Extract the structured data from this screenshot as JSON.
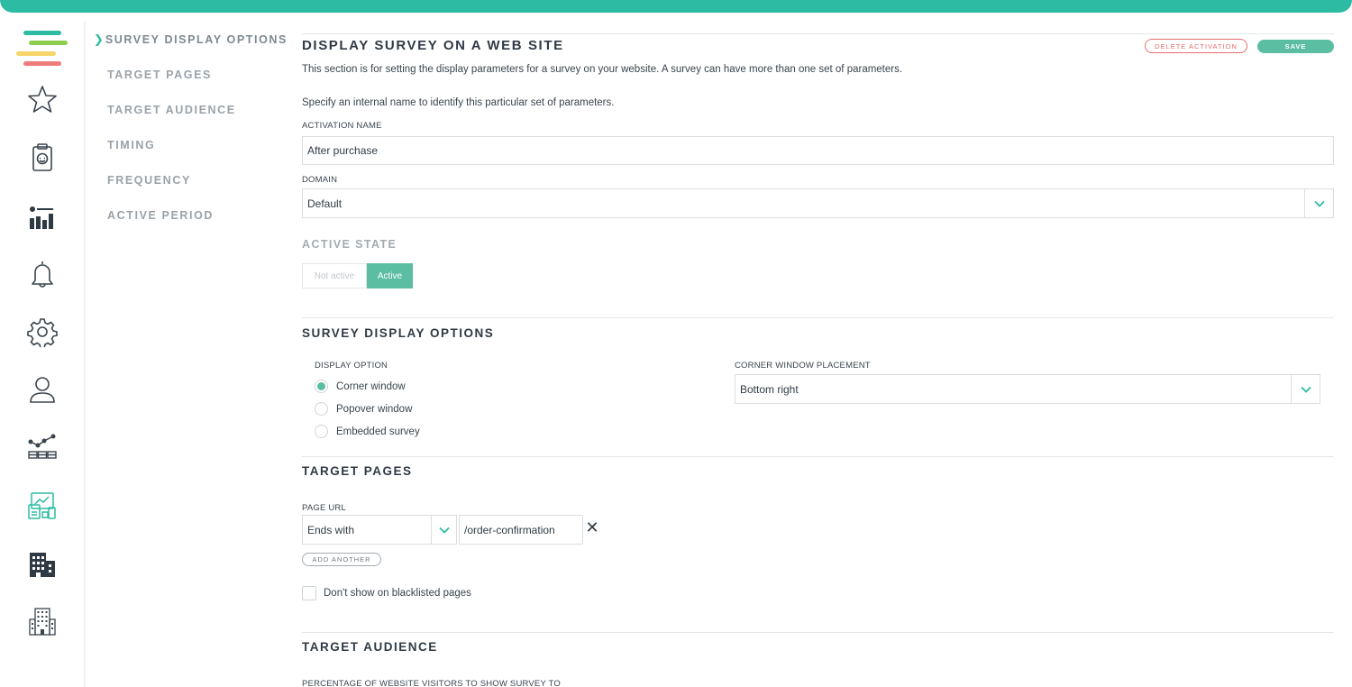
{
  "colors": {
    "accent": "#2dbba3",
    "button": "#5bbea3",
    "danger": "#e86d6d"
  },
  "rail": {
    "icons": [
      "logo-icon",
      "star-icon",
      "survey-clipboard-icon",
      "report-chart-icon",
      "bell-icon",
      "gear-icon",
      "user-icon",
      "analytics-flow-icon",
      "website-devices-icon",
      "building-icon",
      "office-tower-icon"
    ]
  },
  "section_nav": {
    "items": [
      {
        "label": "SURVEY DISPLAY OPTIONS",
        "active": true
      },
      {
        "label": "TARGET PAGES"
      },
      {
        "label": "TARGET AUDIENCE"
      },
      {
        "label": "TIMING"
      },
      {
        "label": "FREQUENCY"
      },
      {
        "label": "ACTIVE PERIOD"
      }
    ]
  },
  "header": {
    "title": "DISPLAY SURVEY ON A WEB SITE",
    "delete_label": "DELETE ACTIVATION",
    "save_label": "SAVE"
  },
  "intro": {
    "description": "This section is for setting the display parameters for a survey on your website. A survey can have more than one set of parameters.",
    "name_hint": "Specify an internal name to identify this particular set of parameters."
  },
  "activation": {
    "name_label": "ACTIVATION NAME",
    "name_value": "After purchase",
    "domain_label": "DOMAIN",
    "domain_value": "Default"
  },
  "active_state": {
    "heading": "ACTIVE STATE",
    "off_label": "Not active",
    "on_label": "Active",
    "selected": "Active"
  },
  "display_options": {
    "heading": "SURVEY DISPLAY OPTIONS",
    "option_label": "DISPLAY OPTION",
    "options": [
      "Corner window",
      "Popover window",
      "Embedded survey"
    ],
    "selected": "Corner window",
    "placement_label": "CORNER WINDOW PLACEMENT",
    "placement_value": "Bottom right"
  },
  "target_pages": {
    "heading": "TARGET PAGES",
    "url_label": "PAGE URL",
    "match_value": "Ends with",
    "url_value": "/order-confirmation",
    "remove_glyph": "✕",
    "add_label": "ADD ANOTHER",
    "blacklist_label": "Don't show on blacklisted pages",
    "blacklist_checked": false
  },
  "target_audience": {
    "heading": "TARGET AUDIENCE",
    "percent_label": "PERCENTAGE OF WEBSITE VISITORS TO SHOW SURVEY TO"
  }
}
